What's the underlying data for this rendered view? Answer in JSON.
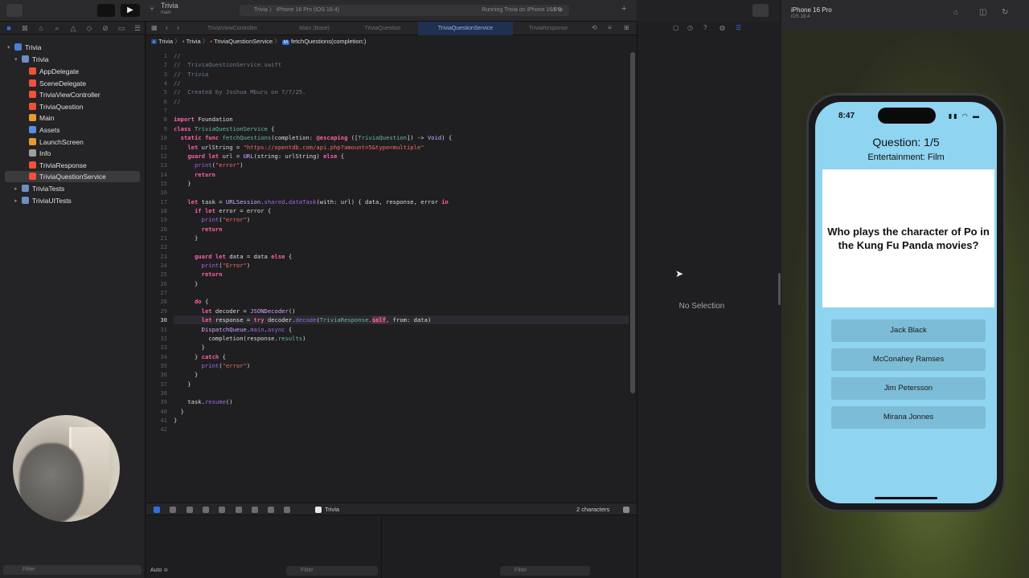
{
  "toolbar": {
    "scheme_name": "Trivia",
    "scheme_sub": "main",
    "breadcrumb": "Trivia  〉  iPhone 16 Pro (iOS 18.4)",
    "status": "Running Trivia on iPhone 16 Pro",
    "issues": "⚠ 3",
    "add": "+"
  },
  "navigator": {
    "project": "Trivia",
    "group": "Trivia",
    "items": [
      {
        "label": "AppDelegate",
        "icon": "swift-file-icon",
        "color": "#f05138"
      },
      {
        "label": "SceneDelegate",
        "icon": "swift-file-icon",
        "color": "#f05138"
      },
      {
        "label": "TriviaViewController",
        "icon": "swift-file-icon",
        "color": "#f05138"
      },
      {
        "label": "TriviaQuestion",
        "icon": "swift-file-icon",
        "color": "#f05138"
      },
      {
        "label": "Main",
        "icon": "storyboard-icon",
        "color": "#e89a2c"
      },
      {
        "label": "Assets",
        "icon": "assets-icon",
        "color": "#5a8fe0"
      },
      {
        "label": "LaunchScreen",
        "icon": "storyboard-icon",
        "color": "#e89a2c"
      },
      {
        "label": "Info",
        "icon": "plist-icon",
        "color": "#9e9e9e"
      },
      {
        "label": "TriviaResponse",
        "icon": "swift-file-icon",
        "color": "#f05138"
      },
      {
        "label": "TriviaQuestionService",
        "icon": "swift-file-icon",
        "color": "#f05138"
      }
    ],
    "tests": [
      "TriviaTests",
      "TriviaUITests"
    ],
    "filter_placeholder": "Filter"
  },
  "editor": {
    "tabs": [
      "TriviaViewController",
      "Main (Base)",
      "TriviaQuestion",
      "TriviaQuestionService",
      "TriviaResponse"
    ],
    "active_tab": "TriviaQuestionService",
    "jump": [
      "Trivia",
      "Trivia",
      "TriviaQuestionService",
      "fetchQuestions(completion:)"
    ],
    "selection_status": "2 characters",
    "debug_target": "Trivia",
    "console_auto": "Auto ≎",
    "console_filter": "Filter",
    "console_filter2": "Filter"
  },
  "inspector": {
    "empty": "No Selection"
  },
  "simulator": {
    "device": "iPhone 16 Pro",
    "os": "iOS 18.4",
    "time": "8:47",
    "question_title": "Question: 1/5",
    "category": "Entertainment: Film",
    "question": "Who plays the character of Po in the Kung Fu Panda movies?",
    "answers": [
      "Jack Black",
      "McConahey Ramses",
      "Jim Petersson",
      "Mirana Jonnes"
    ]
  },
  "colors": {
    "accent": "#2f6fe0",
    "sim_background": "#8fd4f1",
    "answer_button": "#7cbcd6"
  }
}
